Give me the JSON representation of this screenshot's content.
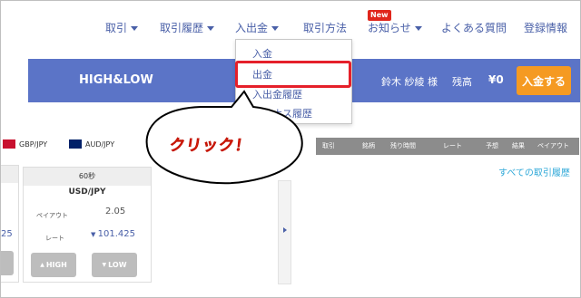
{
  "nav": {
    "items": [
      {
        "label": "取引",
        "has_caret": true
      },
      {
        "label": "取引履歴",
        "has_caret": true
      },
      {
        "label": "入出金",
        "has_caret": true
      },
      {
        "label": "取引方法",
        "has_caret": false
      },
      {
        "label": "お知らせ",
        "has_caret": true
      },
      {
        "label": "よくある質問",
        "has_caret": false
      },
      {
        "label": "登録情報",
        "has_caret": false
      }
    ],
    "new_badge": "New"
  },
  "header": {
    "brand": "HIGH&LOW",
    "user_name": "鈴木 紗綾 様",
    "balance_label": "残高",
    "balance_value": "¥0",
    "deposit_button": "入金する"
  },
  "dropdown": {
    "items": [
      "入金",
      "出金",
      "入出金履歴",
      "ボーナス履歴"
    ],
    "highlighted": "出金"
  },
  "annotation": {
    "bubble_text": "クリック！"
  },
  "pairs": [
    "GBP/JPY",
    "AUD/JPY"
  ],
  "trade_panel": {
    "duration": "60秒",
    "pair": "USD/JPY",
    "payout_label": "ペイアウト",
    "payout_value": "2.05",
    "rate_label": "レート",
    "rate_value": "101.425",
    "left_partial_rate": "25",
    "high_button": "HIGH",
    "low_button": "LOW"
  },
  "history": {
    "columns": [
      "取引",
      "銘柄",
      "残り時間",
      "レート",
      "予想",
      "結果",
      "ペイアウト"
    ],
    "all_history_link": "すべての取引履歴"
  },
  "colors": {
    "header_blue": "#5b74c7",
    "nav_text": "#4a60a8",
    "deposit_orange": "#f59a22",
    "highlight_red": "#e5202a",
    "link_cyan": "#2ea8d8",
    "badge_red": "#e0261c"
  }
}
